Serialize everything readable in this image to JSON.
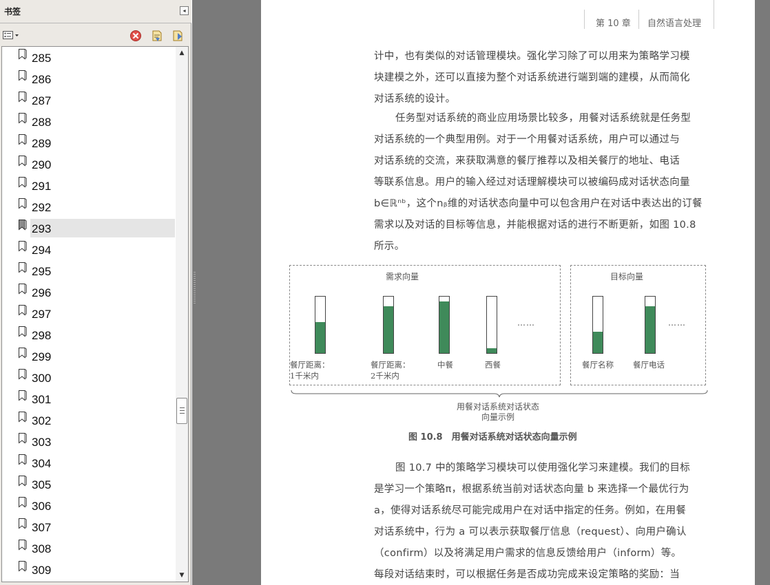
{
  "panel": {
    "title": "书签",
    "collapse_icon": "◂",
    "options_icon": "options-menu-icon",
    "delete_icon": "delete-bookmark-icon",
    "expand_icon": "expand-bookmark-icon",
    "new_icon": "new-bookmark-icon"
  },
  "bookmarks": {
    "selected": "293",
    "items": [
      "285",
      "286",
      "287",
      "288",
      "289",
      "290",
      "291",
      "292",
      "293",
      "294",
      "295",
      "296",
      "297",
      "298",
      "299",
      "300",
      "301",
      "302",
      "303",
      "304",
      "305",
      "306",
      "307",
      "308",
      "309"
    ]
  },
  "page": {
    "chapter": "第 10 章",
    "chapter_title": "自然语言处理",
    "para1": [
      "计中，也有类似的对话管理模块。强化学习除了可以用来为策略学习模",
      "块建模之外，还可以直接为整个对话系统进行端到端的建模，从而简化",
      "对话系统的设计。"
    ],
    "para2": [
      "任务型对话系统的商业应用场景比较多，用餐对话系统就是任务型",
      "对话系统的一个典型用例。对于一个用餐对话系统，用户可以通过与",
      "对话系统的交流，来获取满意的餐厅推荐以及相关餐厅的地址、电话",
      "等联系信息。用户的输入经过对话理解模块可以被编码成对话状态向量",
      "b∈ℝⁿᵇ，这个nᵦ维的对话状态向量中可以包含用户在对话中表达出的订餐",
      "需求以及对话的目标等信息，并能根据对话的进行不断更新，如图 10.8",
      "所示。"
    ],
    "para3": [
      "图 10.7 中的策略学习模块可以使用强化学习来建模。我们的目标",
      "是学习一个策略π，根据系统当前对话状态向量 b 来选择一个最优行为",
      "a，使得对话系统尽可能完成用户在对话中指定的任务。例如，在用餐",
      "对话系统中，行为 a 可以表示获取餐厅信息（request）、向用户确认",
      "（confirm）以及将满足用户需求的信息反馈给用户（inform）等。",
      "每段对话结束时，可以根据任务是否成功完成来设定策略的奖励：当"
    ]
  },
  "figure": {
    "left_title": "需求向量",
    "right_title": "目标向量",
    "ellipsis": "……",
    "bars_left": [
      {
        "label_1": "餐厅距离：",
        "label_2": "1千米内",
        "fill": 0.55
      },
      {
        "label_1": "餐厅距离：",
        "label_2": "2千米内",
        "fill": 0.83
      },
      {
        "label_1": "中餐",
        "label_2": "",
        "fill": 0.91
      },
      {
        "label_1": "西餐",
        "label_2": "",
        "fill": 0.08
      }
    ],
    "bars_right": [
      {
        "label_1": "餐厅名称",
        "label_2": "",
        "fill": 0.38
      },
      {
        "label_1": "餐厅电话",
        "label_2": "",
        "fill": 0.83
      }
    ],
    "brace_label_1": "用餐对话系统对话状态",
    "brace_label_2": "向量示例",
    "caption": "图 10.8　用餐对话系统对话状态向量示例"
  }
}
